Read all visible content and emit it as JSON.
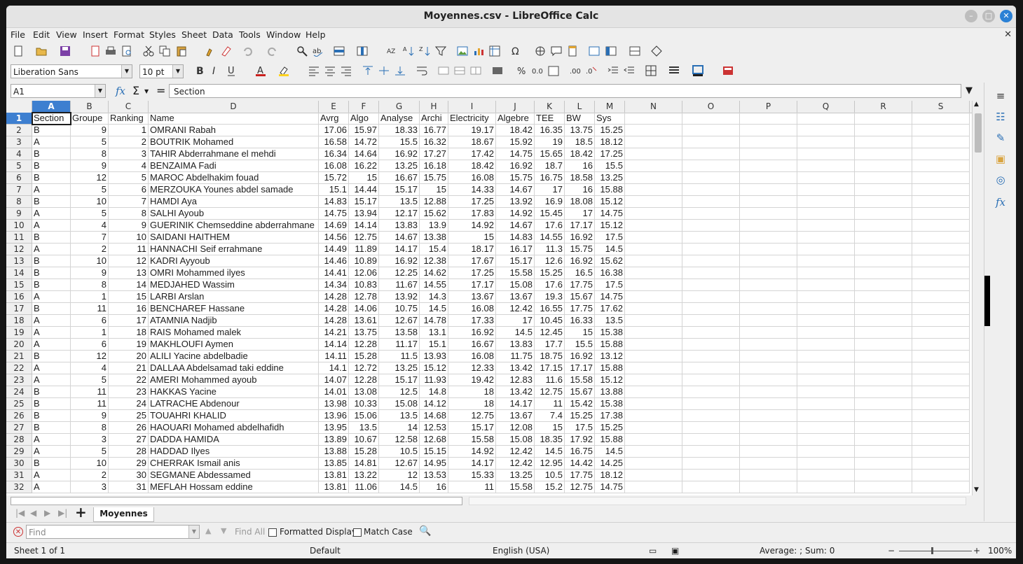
{
  "window": {
    "title": "Moyennes.csv - LibreOffice Calc"
  },
  "menu": [
    "File",
    "Edit",
    "View",
    "Insert",
    "Format",
    "Styles",
    "Sheet",
    "Data",
    "Tools",
    "Window",
    "Help"
  ],
  "format_toolbar": {
    "font_name": "Liberation Sans",
    "font_size": "10 pt"
  },
  "formula_bar": {
    "cell_ref": "A1",
    "content": "Section"
  },
  "columns": [
    "A",
    "B",
    "C",
    "D",
    "E",
    "F",
    "G",
    "H",
    "I",
    "J",
    "K",
    "L",
    "M",
    "N",
    "O",
    "P",
    "Q",
    "R",
    "S"
  ],
  "header_row": [
    "Section",
    "Groupe",
    "Ranking",
    "Name",
    "Avrg",
    "Algo",
    "Analyse",
    "Archi",
    "Electricity",
    "Algebre",
    "TEE",
    "BW",
    "Sys"
  ],
  "rows": [
    [
      "B",
      "9",
      "1",
      "OMRANI Rabah",
      "17.06",
      "15.97",
      "18.33",
      "16.77",
      "19.17",
      "18.42",
      "16.35",
      "13.75",
      "15.25"
    ],
    [
      "A",
      "5",
      "2",
      "BOUTRIK Mohamed",
      "16.58",
      "14.72",
      "15.5",
      "16.32",
      "18.67",
      "15.92",
      "19",
      "18.5",
      "18.12"
    ],
    [
      "B",
      "8",
      "3",
      "TAHIR Abderrahmane el mehdi",
      "16.34",
      "14.64",
      "16.92",
      "17.27",
      "17.42",
      "14.75",
      "15.65",
      "18.42",
      "17.25"
    ],
    [
      "B",
      "9",
      "4",
      "BENZAIMA Fadi",
      "16.08",
      "16.22",
      "13.25",
      "16.18",
      "18.42",
      "16.92",
      "18.7",
      "16",
      "15.5"
    ],
    [
      "B",
      "12",
      "5",
      "MAROC Abdelhakim fouad",
      "15.72",
      "15",
      "16.67",
      "15.75",
      "16.08",
      "15.75",
      "16.75",
      "18.58",
      "13.25"
    ],
    [
      "A",
      "5",
      "6",
      "MERZOUKA Younes abdel samade",
      "15.1",
      "14.44",
      "15.17",
      "15",
      "14.33",
      "14.67",
      "17",
      "16",
      "15.88"
    ],
    [
      "B",
      "10",
      "7",
      "HAMDI Aya",
      "14.83",
      "15.17",
      "13.5",
      "12.88",
      "17.25",
      "13.92",
      "16.9",
      "18.08",
      "15.12"
    ],
    [
      "A",
      "5",
      "8",
      "SALHI Ayoub",
      "14.75",
      "13.94",
      "12.17",
      "15.62",
      "17.83",
      "14.92",
      "15.45",
      "17",
      "14.75"
    ],
    [
      "A",
      "4",
      "9",
      "GUERINIK Chemseddine abderrahmane",
      "14.69",
      "14.14",
      "13.83",
      "13.9",
      "14.92",
      "14.67",
      "17.6",
      "17.17",
      "15.12"
    ],
    [
      "B",
      "7",
      "10",
      "SAIDANI HAITHEM",
      "14.56",
      "12.75",
      "14.67",
      "13.38",
      "15",
      "14.83",
      "14.55",
      "16.92",
      "17.5"
    ],
    [
      "A",
      "2",
      "11",
      "HANNACHI Seif errahmane",
      "14.49",
      "11.89",
      "14.17",
      "15.4",
      "18.17",
      "16.17",
      "11.3",
      "15.75",
      "14.5"
    ],
    [
      "B",
      "10",
      "12",
      "KADRI Ayyoub",
      "14.46",
      "10.89",
      "16.92",
      "12.38",
      "17.67",
      "15.17",
      "12.6",
      "16.92",
      "15.62"
    ],
    [
      "B",
      "9",
      "13",
      "OMRI Mohammed ilyes",
      "14.41",
      "12.06",
      "12.25",
      "14.62",
      "17.25",
      "15.58",
      "15.25",
      "16.5",
      "16.38"
    ],
    [
      "B",
      "8",
      "14",
      "MEDJAHED Wassim",
      "14.34",
      "10.83",
      "11.67",
      "14.55",
      "17.17",
      "15.08",
      "17.6",
      "17.75",
      "17.5"
    ],
    [
      "A",
      "1",
      "15",
      "LARBI Arslan",
      "14.28",
      "12.78",
      "13.92",
      "14.3",
      "13.67",
      "13.67",
      "19.3",
      "15.67",
      "14.75"
    ],
    [
      "B",
      "11",
      "16",
      "BENCHAREF Hassane",
      "14.28",
      "14.06",
      "10.75",
      "14.5",
      "16.08",
      "12.42",
      "16.55",
      "17.75",
      "17.62"
    ],
    [
      "A",
      "6",
      "17",
      "ATAMNIA Nadjib",
      "14.28",
      "13.61",
      "12.67",
      "14.78",
      "17.33",
      "17",
      "10.45",
      "16.33",
      "13.5"
    ],
    [
      "A",
      "1",
      "18",
      "RAIS Mohamed malek",
      "14.21",
      "13.75",
      "13.58",
      "13.1",
      "16.92",
      "14.5",
      "12.45",
      "15",
      "15.38"
    ],
    [
      "A",
      "6",
      "19",
      "MAKHLOUFI Aymen",
      "14.14",
      "12.28",
      "11.17",
      "15.1",
      "16.67",
      "13.83",
      "17.7",
      "15.5",
      "15.88"
    ],
    [
      "B",
      "12",
      "20",
      "ALILI Yacine abdelbadie",
      "14.11",
      "15.28",
      "11.5",
      "13.93",
      "16.08",
      "11.75",
      "18.75",
      "16.92",
      "13.12"
    ],
    [
      "A",
      "4",
      "21",
      "DALLAA Abdelsamad taki eddine",
      "14.1",
      "12.72",
      "13.25",
      "15.12",
      "12.33",
      "13.42",
      "17.15",
      "17.17",
      "15.88"
    ],
    [
      "A",
      "5",
      "22",
      "AMERI Mohammed ayoub",
      "14.07",
      "12.28",
      "15.17",
      "11.93",
      "19.42",
      "12.83",
      "11.6",
      "15.58",
      "15.12"
    ],
    [
      "B",
      "11",
      "23",
      "HAKKAS Yacine",
      "14.01",
      "13.08",
      "12.5",
      "14.8",
      "18",
      "13.42",
      "12.75",
      "15.67",
      "13.88"
    ],
    [
      "B",
      "11",
      "24",
      "LATRACHE Abdenour",
      "13.98",
      "10.33",
      "15.08",
      "14.12",
      "18",
      "14.17",
      "11",
      "15.42",
      "15.38"
    ],
    [
      "B",
      "9",
      "25",
      "TOUAHRI KHALID",
      "13.96",
      "15.06",
      "13.5",
      "14.68",
      "12.75",
      "13.67",
      "7.4",
      "15.25",
      "17.38"
    ],
    [
      "B",
      "8",
      "26",
      "HAOUARI Mohamed abdelhafidh",
      "13.95",
      "13.5",
      "14",
      "12.53",
      "15.17",
      "12.08",
      "15",
      "17.5",
      "15.25"
    ],
    [
      "A",
      "3",
      "27",
      "DADDA HAMIDA",
      "13.89",
      "10.67",
      "12.58",
      "12.68",
      "15.58",
      "15.08",
      "18.35",
      "17.92",
      "15.88"
    ],
    [
      "A",
      "5",
      "28",
      "HADDAD Ilyes",
      "13.88",
      "15.28",
      "10.5",
      "15.15",
      "14.92",
      "12.42",
      "14.5",
      "16.75",
      "14.5"
    ],
    [
      "B",
      "10",
      "29",
      "CHERRAK Ismail anis",
      "13.85",
      "14.81",
      "12.67",
      "14.95",
      "14.17",
      "12.42",
      "12.95",
      "14.42",
      "14.25"
    ],
    [
      "A",
      "2",
      "30",
      "SEGMANE Abdessamed",
      "13.81",
      "13.22",
      "12",
      "13.53",
      "15.33",
      "13.25",
      "10.5",
      "17.75",
      "18.12"
    ],
    [
      "A",
      "3",
      "31",
      "MEFLAH Hossam eddine",
      "13.81",
      "11.06",
      "14.5",
      "16",
      "11",
      "15.58",
      "15.2",
      "12.75",
      "14.75"
    ]
  ],
  "sheet_tab": "Moyennes",
  "find_bar": {
    "placeholder": "Find",
    "find_all": "Find All",
    "formatted_display": "Formatted Display",
    "match_case": "Match Case"
  },
  "status": {
    "sheet": "Sheet 1 of 1",
    "style": "Default",
    "language": "English (USA)",
    "summary": "Average: ; Sum: 0",
    "zoom": "100%"
  }
}
